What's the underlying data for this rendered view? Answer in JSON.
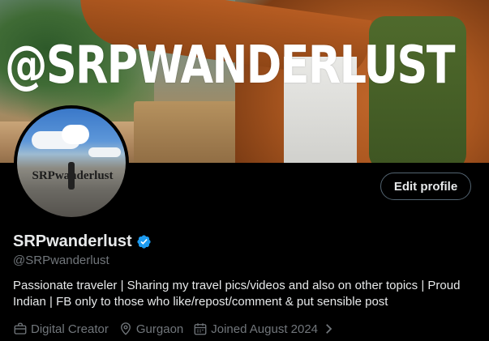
{
  "banner": {
    "handle_text": "@SRPWANDERLUST"
  },
  "avatar": {
    "label": "SRPwanderlust"
  },
  "actions": {
    "edit_profile_label": "Edit profile"
  },
  "profile": {
    "display_name": "SRPwanderlust",
    "handle": "@SRPwanderlust",
    "verified": true,
    "bio": "Passionate traveler | Sharing my travel pics/videos and also on other topics | Proud Indian | FB only to those who like/repost/comment & put sensible post",
    "meta": {
      "category": "Digital Creator",
      "location": "Gurgaon",
      "joined": "Joined August 2024"
    }
  },
  "colors": {
    "background": "#000000",
    "primary_text": "#e7e9ea",
    "secondary_text": "#71767b",
    "verified_badge": "#1d9bf0",
    "button_border": "#536471"
  },
  "icons": {
    "verified": "verified-badge-icon",
    "category": "briefcase-icon",
    "location": "location-pin-icon",
    "joined": "calendar-icon",
    "more": "chevron-right-icon"
  }
}
